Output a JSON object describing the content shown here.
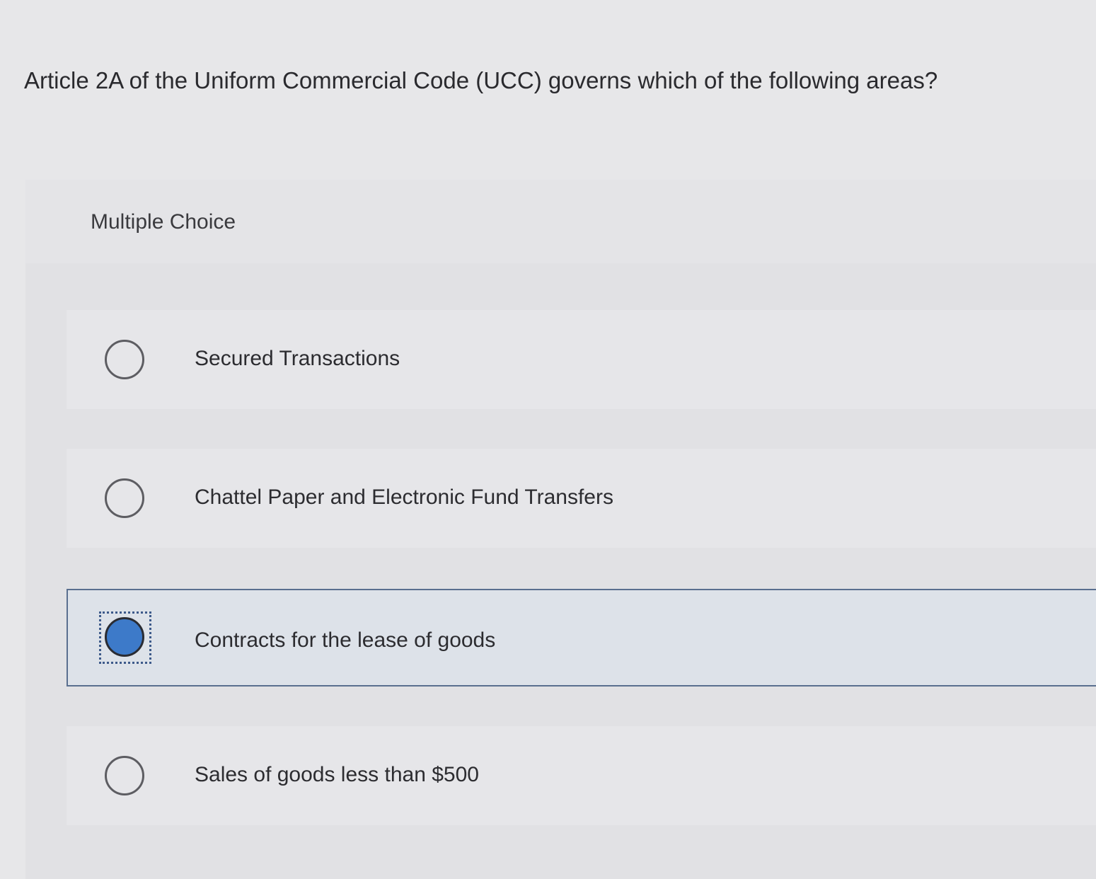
{
  "question": {
    "text": "Article 2A of the Uniform Commercial Code (UCC) governs which of the following areas?"
  },
  "panel": {
    "label": "Multiple Choice"
  },
  "options": [
    {
      "label": "Secured Transactions",
      "selected": false
    },
    {
      "label": "Chattel Paper and Electronic Fund Transfers",
      "selected": false
    },
    {
      "label": "Contracts for the lease of goods",
      "selected": true
    },
    {
      "label": "Sales of goods less than $500",
      "selected": false
    }
  ],
  "colors": {
    "selected_radio": "#3d7ac9",
    "selected_border": "#5a6f8f",
    "background": "#e7e7e9"
  }
}
